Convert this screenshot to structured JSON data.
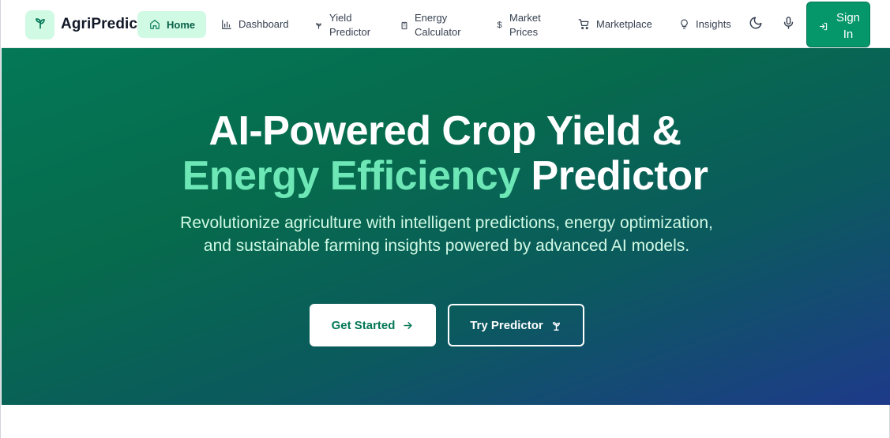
{
  "brand": {
    "name": "AgriPredict",
    "logo_icon": "sprout-icon"
  },
  "nav": {
    "items": [
      {
        "label": "Home",
        "icon": "home-icon",
        "active": true
      },
      {
        "label": "Dashboard",
        "icon": "bar-chart-icon"
      },
      {
        "label_line1": "Yield",
        "label_line2": "Predictor",
        "icon": "sprout-icon"
      },
      {
        "label_line1": "Energy",
        "label_line2": "Calculator",
        "icon": "calculator-icon"
      },
      {
        "label_line1": "Market",
        "label_line2": "Prices",
        "icon": "dollar-icon"
      },
      {
        "label": "Marketplace",
        "icon": "cart-icon"
      },
      {
        "label": "Insights",
        "icon": "lightbulb-icon"
      }
    ],
    "theme_toggle_icon": "moon-icon",
    "voice_icon": "microphone-icon",
    "signin": {
      "line1": "Sign",
      "line2": "In",
      "icon": "login-icon"
    }
  },
  "hero": {
    "title_line1": "AI-Powered Crop Yield &",
    "title_accent": "Energy Efficiency",
    "title_rest": " Predictor",
    "subtitle": "Revolutionize agriculture with intelligent predictions, energy optimization, and sustainable farming insights powered by advanced AI models.",
    "primary_button": "Get Started",
    "secondary_button": "Try Predictor"
  },
  "colors": {
    "accent": "#059669",
    "accent_light": "#6ee7b7",
    "gradient_start": "#047857",
    "gradient_end": "#1e3a8a"
  }
}
